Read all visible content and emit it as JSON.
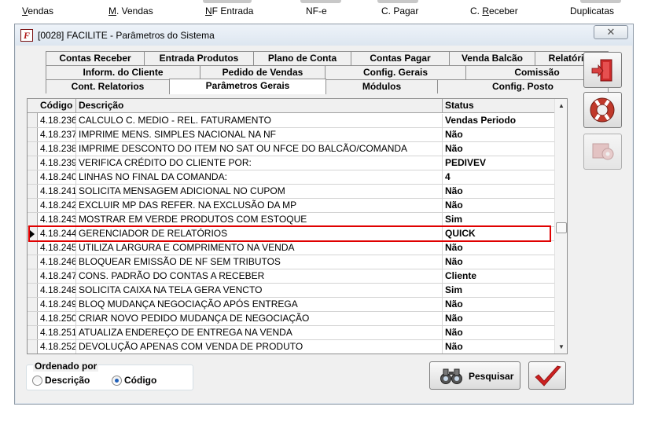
{
  "toolbar": {
    "items": [
      {
        "pre": "",
        "ul": "V",
        "post": "endas"
      },
      {
        "pre": "",
        "ul": "M",
        "post": ". Vendas"
      },
      {
        "pre": "",
        "ul": "N",
        "post": "F Entrada"
      },
      {
        "pre": "NF-e",
        "ul": "",
        "post": ""
      },
      {
        "pre": "C. Pagar",
        "ul": "",
        "post": ""
      },
      {
        "pre": "C. ",
        "ul": "R",
        "post": "eceber"
      },
      {
        "pre": "Duplicatas",
        "ul": "",
        "post": ""
      }
    ]
  },
  "window": {
    "icon_letter": "F",
    "title": "[0028] FACILITE - Parâmetros do Sistema",
    "close_glyph": "✕"
  },
  "tabs": {
    "row1": [
      "Contas Receber",
      "Entrada Produtos",
      "Plano de Conta",
      "Contas Pagar",
      "Venda Balcão",
      "Relatórios"
    ],
    "row2": [
      "Inform. do Cliente",
      "Pedido de Vendas",
      "Config. Gerais",
      "Comissão"
    ],
    "row3": [
      "Cont. Relatorios",
      "Parâmetros Gerais",
      "Módulos",
      "Config. Posto"
    ],
    "active": "Parâmetros Gerais"
  },
  "grid": {
    "columns": [
      "Código",
      "Descrição",
      "Status"
    ],
    "selected_code": "4.18.244",
    "rows": [
      {
        "code": "4.18.236",
        "desc": "CALCULO C. MEDIO - REL. FATURAMENTO",
        "status": "Vendas Periodo"
      },
      {
        "code": "4.18.237",
        "desc": "IMPRIME MENS. SIMPLES NACIONAL NA NF",
        "status": "Não"
      },
      {
        "code": "4.18.238",
        "desc": "IMPRIME DESCONTO DO ITEM NO SAT OU NFCE DO BALCÃO/COMANDA",
        "status": "Não"
      },
      {
        "code": "4.18.239",
        "desc": "VERIFICA CRÉDITO DO CLIENTE POR:",
        "status": "PEDIVEV"
      },
      {
        "code": "4.18.240",
        "desc": "LINHAS NO FINAL DA COMANDA:",
        "status": "4"
      },
      {
        "code": "4.18.241",
        "desc": "SOLICITA MENSAGEM ADICIONAL NO CUPOM",
        "status": "Não"
      },
      {
        "code": "4.18.242",
        "desc": "EXCLUIR MP DAS REFER. NA EXCLUSÃO DA MP",
        "status": "Não"
      },
      {
        "code": "4.18.243",
        "desc": "MOSTRAR EM VERDE PRODUTOS COM ESTOQUE",
        "status": "Sim"
      },
      {
        "code": "4.18.244",
        "desc": "GERENCIADOR DE RELATÓRIOS",
        "status": "QUICK"
      },
      {
        "code": "4.18.245",
        "desc": "UTILIZA LARGURA E COMPRIMENTO NA VENDA",
        "status": "Não"
      },
      {
        "code": "4.18.246",
        "desc": "BLOQUEAR EMISSÃO DE NF SEM TRIBUTOS",
        "status": "Não"
      },
      {
        "code": "4.18.247",
        "desc": "CONS. PADRÃO DO CONTAS A RECEBER",
        "status": "Cliente"
      },
      {
        "code": "4.18.248",
        "desc": "SOLICITA CAIXA NA TELA GERA VENCTO",
        "status": "Sim"
      },
      {
        "code": "4.18.249",
        "desc": "BLOQ MUDANÇA NEGOCIAÇÃO APÓS ENTREGA",
        "status": "Não"
      },
      {
        "code": "4.18.250",
        "desc": "CRIAR NOVO PEDIDO MUDANÇA DE NEGOCIAÇÃO",
        "status": "Não"
      },
      {
        "code": "4.18.251",
        "desc": "ATUALIZA ENDEREÇO DE ENTREGA NA VENDA",
        "status": "Não"
      },
      {
        "code": "4.18.252",
        "desc": "DEVOLUÇÃO APENAS COM VENDA DE PRODUTO",
        "status": "Não"
      }
    ]
  },
  "order": {
    "legend": "Ordenado por",
    "options": [
      "Descrição",
      "Código"
    ],
    "selected": "Código"
  },
  "buttons": {
    "search_label": "Pesquisar"
  },
  "colors": {
    "selection_border": "#e00000",
    "exit_icon": "#cc2a2a",
    "help_icon": "#c0392b",
    "confirm_check": "#cc2020"
  }
}
